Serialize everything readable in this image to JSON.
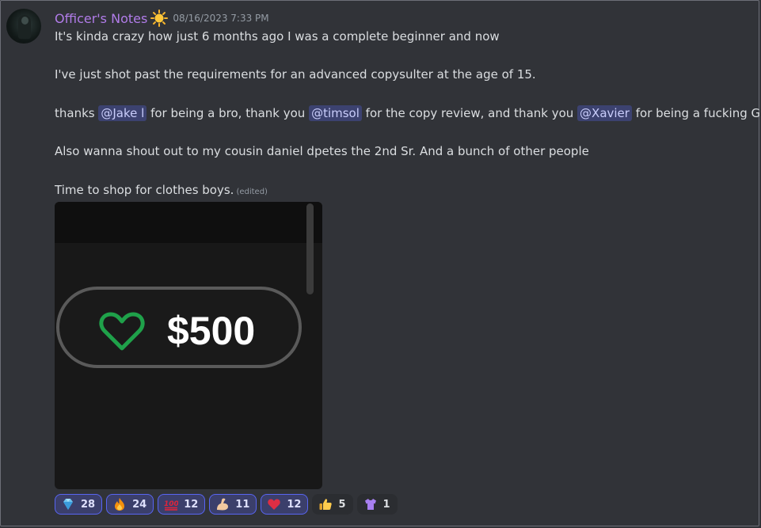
{
  "message": {
    "author": "Officer's Notes",
    "timestamp": "08/16/2023 7:33 PM",
    "line1": "It's kinda crazy how just 6 months ago I was a complete beginner and now",
    "line2": "I've just shot past the requirements for an advanced copysulter at the age of 15.",
    "line3": {
      "t1": "thanks ",
      "m1": "@Jake l",
      "t2": " for being a bro, thank you ",
      "m2": "@timsol",
      "t3": " for the copy review, and thank you ",
      "m3": "@Xavier",
      "t4": " for being a fucking G."
    },
    "line4": "Also wanna shout out to my cousin daniel dpetes the 2nd Sr. And a bunch of other people",
    "line5": "Time to shop for clothes boys.",
    "edited": "(edited)"
  },
  "attachment": {
    "amount": "$500",
    "icon": "heart-outline-icon"
  },
  "reactions": [
    {
      "emoji": "gem-icon",
      "count": "28",
      "active": true
    },
    {
      "emoji": "fire-icon",
      "count": "24",
      "active": true
    },
    {
      "emoji": "hundred-icon",
      "count": "12",
      "active": true
    },
    {
      "emoji": "flexed-biceps-icon",
      "count": "11",
      "active": true
    },
    {
      "emoji": "red-heart-icon",
      "count": "12",
      "active": true
    },
    {
      "emoji": "thumbs-up-icon",
      "count": "5",
      "active": false
    },
    {
      "emoji": "t-shirt-icon",
      "count": "1",
      "active": false
    }
  ],
  "colors": {
    "username": "#b17ce9",
    "mention_bg": "#3c4270",
    "reaction_active_border": "#5865f2",
    "heart": "#1fa14a"
  }
}
